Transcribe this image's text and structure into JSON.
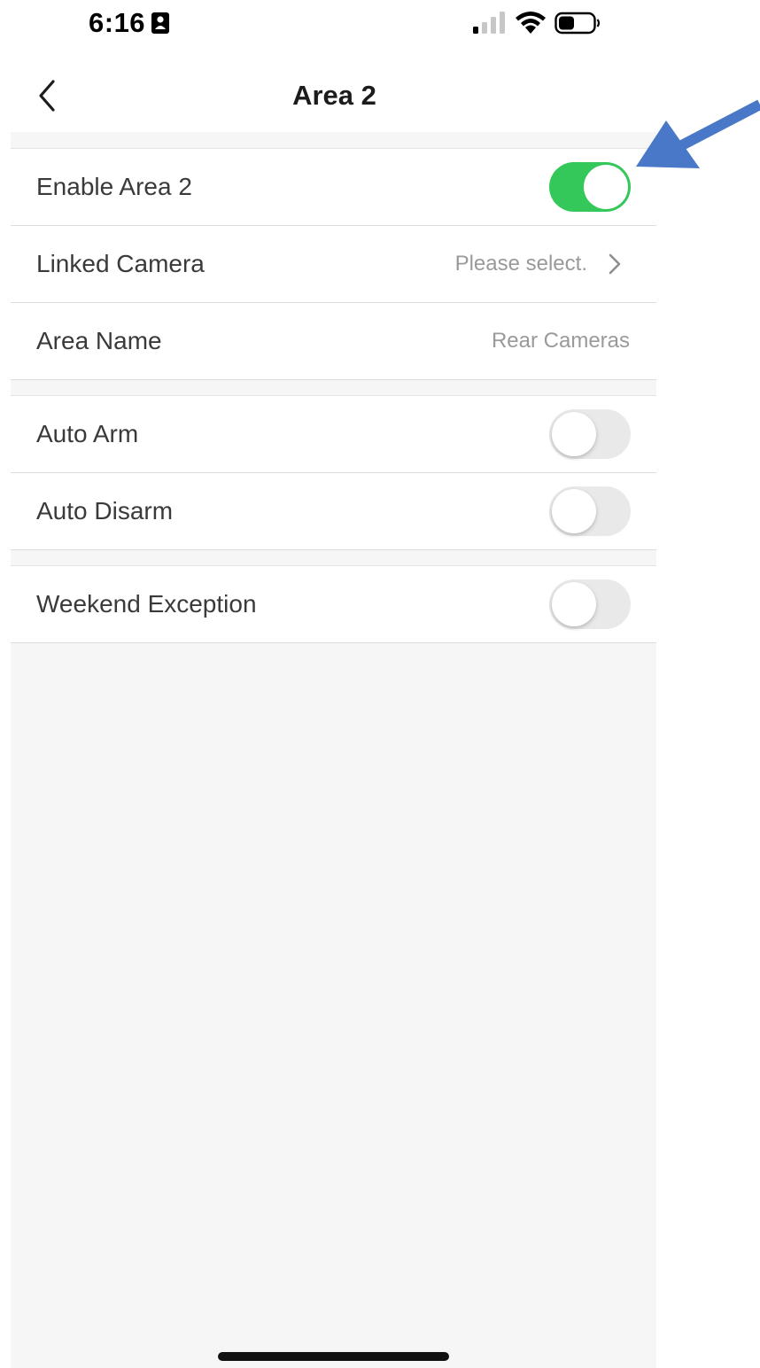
{
  "status_bar": {
    "time": "6:16",
    "icons": [
      "contact-card-icon",
      "signal-icon",
      "wifi-icon",
      "battery-icon"
    ]
  },
  "header": {
    "title": "Area 2",
    "back_icon": "chevron-left-icon"
  },
  "groups": [
    {
      "rows": [
        {
          "label": "Enable Area 2",
          "control": "toggle",
          "on": true
        },
        {
          "label": "Linked Camera",
          "control": "select",
          "value": "Please select.",
          "icon": "chevron-right-icon"
        },
        {
          "label": "Area Name",
          "control": "text",
          "value": "Rear Cameras"
        }
      ]
    },
    {
      "rows": [
        {
          "label": "Auto Arm",
          "control": "toggle",
          "on": false
        },
        {
          "label": "Auto Disarm",
          "control": "toggle",
          "on": false
        }
      ]
    },
    {
      "rows": [
        {
          "label": "Weekend Exception",
          "control": "toggle",
          "on": false
        }
      ]
    }
  ],
  "annotation": {
    "type": "arrow",
    "color": "#4a78c8",
    "points_to": "Enable Area 2 toggle"
  },
  "colors": {
    "toggle_on": "#34c759",
    "toggle_off": "#e9e9ea",
    "background": "#f6f6f6"
  }
}
